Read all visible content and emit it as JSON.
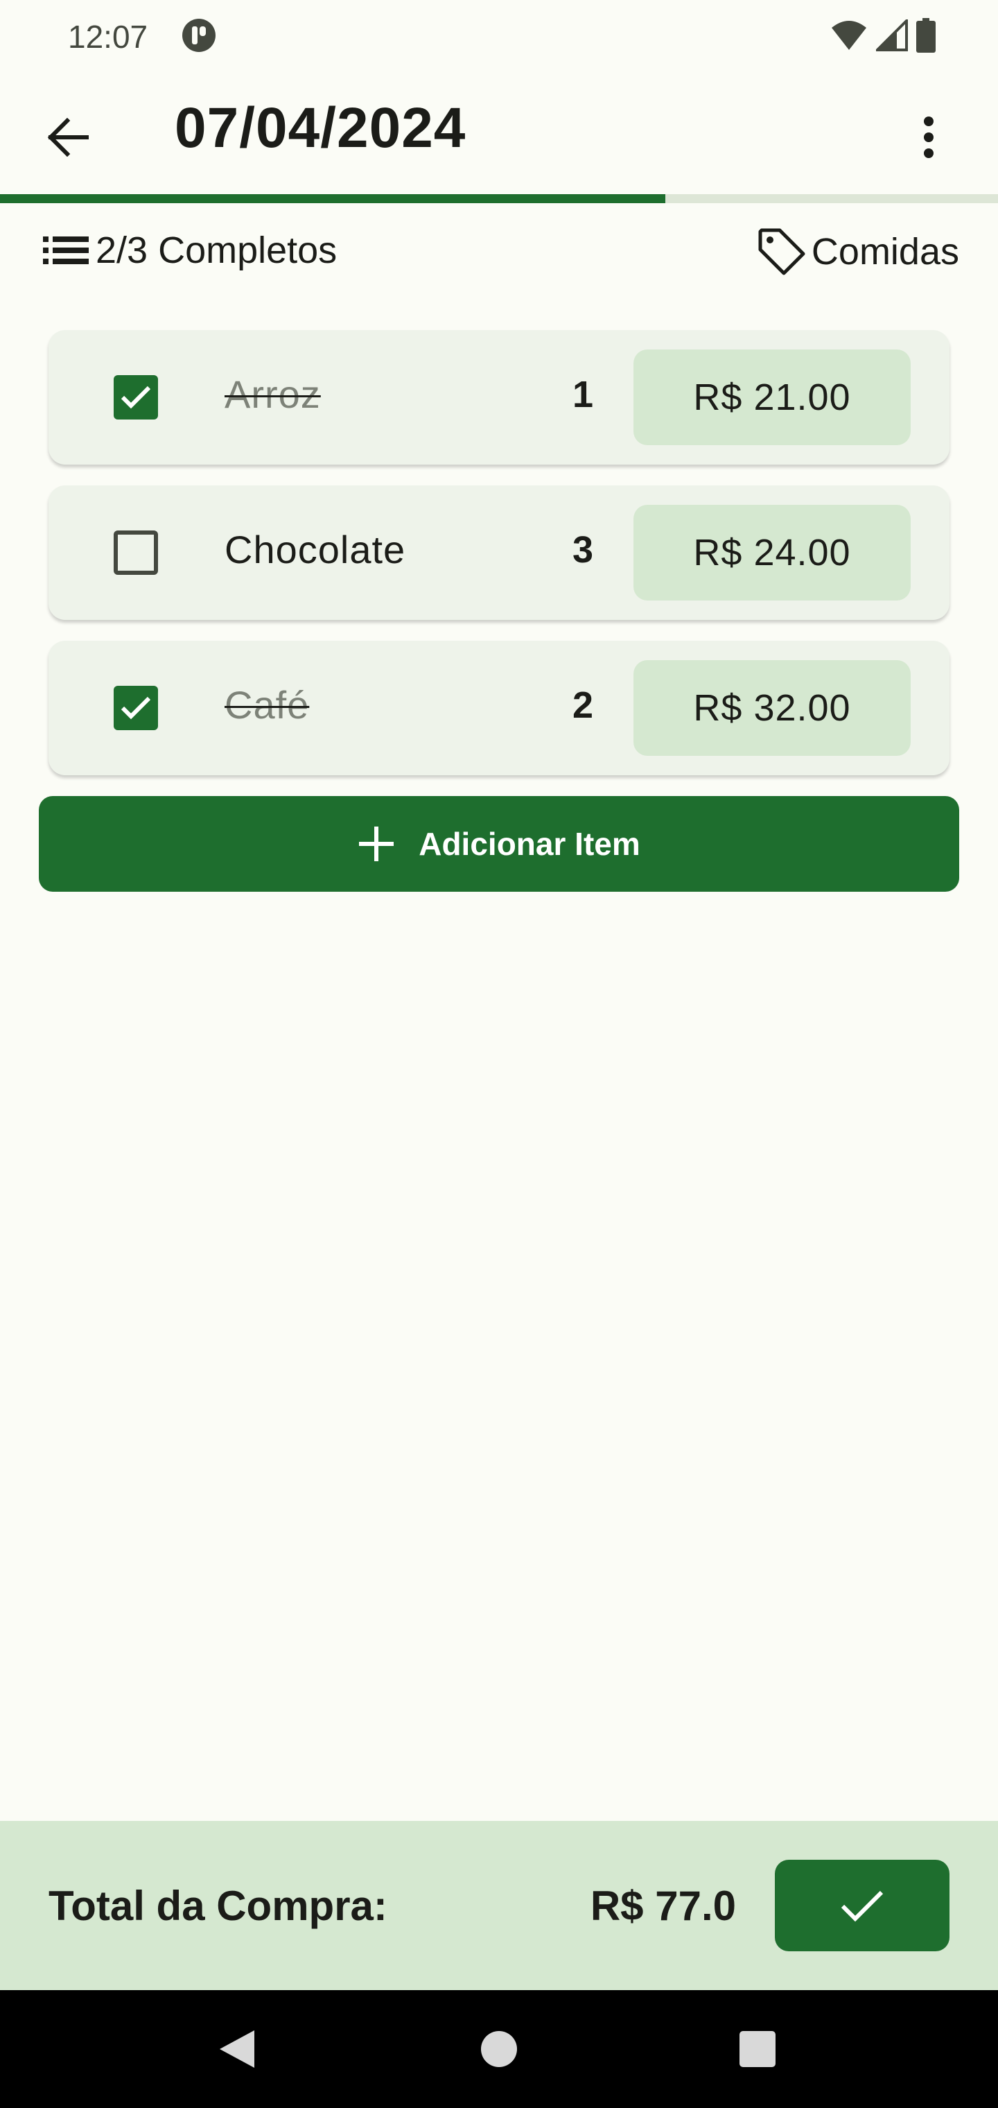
{
  "status_bar": {
    "time": "12:07",
    "icons": [
      "app-notification-icon",
      "wifi-icon",
      "signal-icon",
      "battery-icon"
    ]
  },
  "app_bar": {
    "title": "07/04/2024",
    "icons": [
      "back-arrow-icon",
      "more-vert-icon"
    ]
  },
  "progress": {
    "fraction": 0.667,
    "fill_color": "#1e6e2e",
    "track_color": "#dde6d6"
  },
  "info": {
    "completed_label": "2/3 Completos",
    "category_label": "Comidas",
    "icons": [
      "list-icon",
      "tag-icon"
    ]
  },
  "items": [
    {
      "name": "Arroz",
      "quantity": "1",
      "price": "R$ 21.00",
      "checked": true
    },
    {
      "name": "Chocolate",
      "quantity": "3",
      "price": "R$ 24.00",
      "checked": false
    },
    {
      "name": "Café",
      "quantity": "2",
      "price": "R$ 32.00",
      "checked": true
    }
  ],
  "add_button": {
    "label": "Adicionar Item",
    "icon": "plus-icon"
  },
  "footer": {
    "total_label": "Total da Compra:",
    "total_value": "R$ 77.0",
    "confirm_icon": "check-icon"
  },
  "nav_bar": {
    "icons": [
      "nav-back-icon",
      "nav-home-icon",
      "nav-recents-icon"
    ]
  },
  "colors": {
    "primary": "#1e6e2e",
    "background": "#fbfcf6",
    "card": "#eef3ea",
    "chip": "#d5e8d0"
  }
}
